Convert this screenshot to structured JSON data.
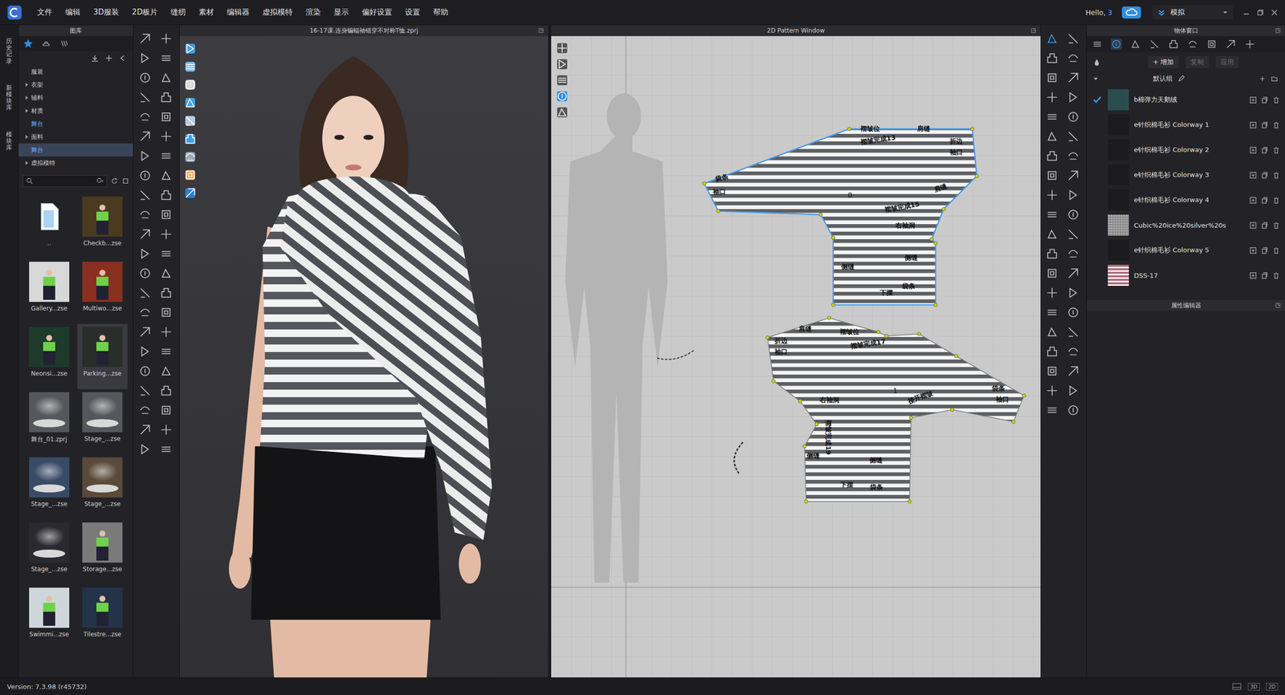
{
  "window": {
    "title": "16-17课.连身蝙蝠袖错穿不对称T恤.zprj"
  },
  "menu": {
    "items": [
      "文件",
      "编辑",
      "3D服装",
      "2D板片",
      "缝纫",
      "素材",
      "编辑器",
      "虚拟模特",
      "渲染",
      "显示",
      "偏好设置",
      "设置",
      "帮助"
    ]
  },
  "account": {
    "greeting": "Hello,",
    "user": "3"
  },
  "mode": {
    "label": "模拟"
  },
  "side_tabs": [
    {
      "label": "历史记录",
      "selected": false
    },
    {
      "label": "新模块库",
      "selected": false
    },
    {
      "label": "模块库",
      "selected": false
    }
  ],
  "library": {
    "title": "图库",
    "tabs": [
      {
        "selected": true
      },
      {
        "selected": false
      },
      {
        "selected": false
      }
    ],
    "tree": [
      {
        "label": "服装",
        "expandable": false,
        "highlighted": false,
        "selected": false
      },
      {
        "label": "衣架",
        "expandable": true,
        "highlighted": false,
        "selected": false
      },
      {
        "label": "辅料",
        "expandable": true,
        "highlighted": false,
        "selected": false
      },
      {
        "label": "材质",
        "expandable": true,
        "highlighted": false,
        "selected": false
      },
      {
        "label": "舞台",
        "expandable": false,
        "highlighted": true,
        "selected": false
      },
      {
        "label": "面料",
        "expandable": true,
        "highlighted": false,
        "selected": false
      },
      {
        "label": "舞台",
        "expandable": false,
        "highlighted": true,
        "selected": true
      },
      {
        "label": "虚拟模特",
        "expandable": true,
        "highlighted": false,
        "selected": false
      }
    ],
    "items": [
      {
        "label": "..",
        "kind": "folder",
        "color": "#dfe8ef",
        "selected": false
      },
      {
        "label": "Checkb...zse",
        "kind": "scene",
        "color": "#4a3a20",
        "selected": false
      },
      {
        "label": "Gallery...zse",
        "kind": "scene",
        "color": "#d8d8d8",
        "selected": false
      },
      {
        "label": "Multiwo...zse",
        "kind": "scene",
        "color": "#8a3020",
        "selected": false
      },
      {
        "label": "Neonsi...zse",
        "kind": "scene",
        "color": "#1e3a2a",
        "selected": false
      },
      {
        "label": "Parking...zse",
        "kind": "scene",
        "color": "#2a2e2a",
        "selected": true
      },
      {
        "label": "舞台_01.zprj",
        "kind": "stage",
        "color": "#55575c",
        "selected": false
      },
      {
        "label": "Stage_...zse",
        "kind": "stage",
        "color": "#55575c",
        "selected": false
      },
      {
        "label": "Stage_...zse",
        "kind": "stage",
        "color": "#3a4a66",
        "selected": false
      },
      {
        "label": "Stage_...zse",
        "kind": "stage",
        "color": "#5a4a3a",
        "selected": false
      },
      {
        "label": "Stage_...zse",
        "kind": "stage",
        "color": "#2a2a30",
        "selected": false
      },
      {
        "label": "Storage...zse",
        "kind": "scene",
        "color": "#7a7a7a",
        "selected": false
      },
      {
        "label": "Swimmi...zse",
        "kind": "scene",
        "color": "#cfd6da",
        "selected": false
      },
      {
        "label": "Tilestre...zse",
        "kind": "scene",
        "color": "#24324a",
        "selected": false
      }
    ]
  },
  "viewport3d": {
    "title": "16-17课.连身蝙蝠袖错穿不对称T恤.zprj"
  },
  "pattern_window": {
    "title": "2D Pattern Window",
    "pieces": [
      {
        "number": "0",
        "selected": true,
        "labels": [
          "褶皱位",
          "褶皱完成13",
          "肩缝",
          "折边",
          "袖口",
          "袋条",
          "袖口",
          "肩缝",
          "褶皱完成15",
          "右袖洞",
          "侧缝",
          "侧缝",
          "下摆",
          "袋条"
        ]
      },
      {
        "number": "1",
        "selected": false,
        "labels": [
          "肩缝",
          "褶皱位",
          "褶皱完成17",
          "折边",
          "袖口",
          "右袖洞",
          "接开褶皱",
          "袋条",
          "袖口",
          "褶皱完成19",
          "侧缝",
          "侧缝",
          "下摆",
          "袋条"
        ]
      }
    ]
  },
  "object_window": {
    "title": "物体窗口",
    "tabs": [
      {
        "selected": false
      },
      {
        "selected": true
      },
      {
        "selected": false
      },
      {
        "selected": false
      },
      {
        "selected": false
      },
      {
        "selected": false
      },
      {
        "selected": false
      },
      {
        "selected": false
      },
      {
        "selected": false
      }
    ],
    "actions": [
      {
        "label": "+ 增加",
        "disabled": false
      },
      {
        "label": "复制",
        "disabled": true
      },
      {
        "label": "应用",
        "disabled": true
      }
    ],
    "group": "默认组",
    "fabrics": [
      {
        "name": "b棉弹力天鹅绒",
        "checked": true,
        "kind": "solid",
        "color": "#2b4d4f"
      },
      {
        "name": "e针织棉毛衫 Colorway 1",
        "checked": false,
        "kind": "solid",
        "color": "#1c1c1e"
      },
      {
        "name": "e针织棉毛衫 Colorway 2",
        "checked": false,
        "kind": "solid",
        "color": "#1c1c1e"
      },
      {
        "name": "e针织棉毛衫 Colorway 3",
        "checked": false,
        "kind": "solid",
        "color": "#1c1c1e"
      },
      {
        "name": "e针织棉毛衫 Colorway 4",
        "checked": false,
        "kind": "solid",
        "color": "#1c1c1e"
      },
      {
        "name": "Cubic%20ice%20silver%20s",
        "checked": false,
        "kind": "texture",
        "color": "#8c8c8c"
      },
      {
        "name": "e针织棉毛衫 Colorway 5",
        "checked": false,
        "kind": "solid",
        "color": "#1c1c1e"
      },
      {
        "name": "DSS-17",
        "checked": false,
        "kind": "print",
        "color": "#b06a7a"
      }
    ]
  },
  "property_editor": {
    "title": "属性编辑器"
  },
  "status_bar": {
    "version": "Version: 7.3.98 (r45732)",
    "views": [
      "3D",
      "2D"
    ]
  }
}
